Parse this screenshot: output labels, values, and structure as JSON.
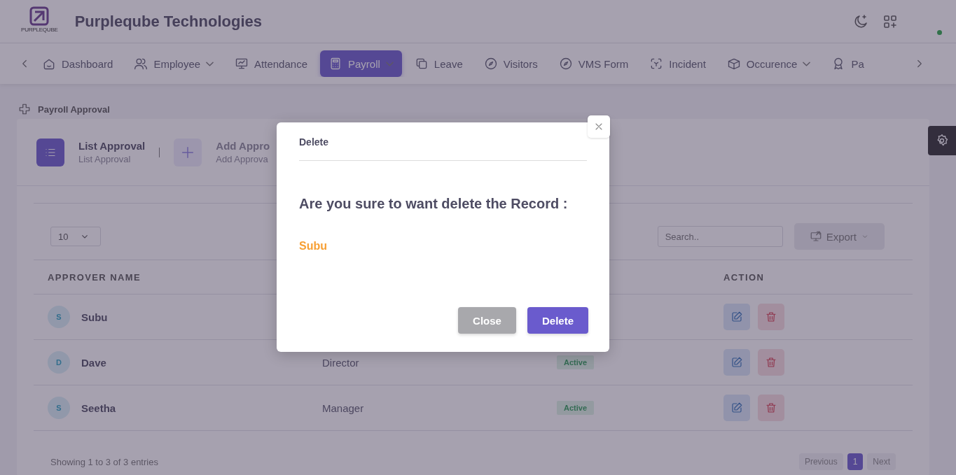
{
  "header": {
    "logo_text": "PURPLEQUBE",
    "company": "Purpleqube Technologies"
  },
  "nav": {
    "items": [
      {
        "label": "Dashboard",
        "dropdown": false,
        "selected": false
      },
      {
        "label": "Employee",
        "dropdown": true,
        "selected": false
      },
      {
        "label": "Attendance",
        "dropdown": false,
        "selected": false
      },
      {
        "label": "Payroll",
        "dropdown": true,
        "selected": true
      },
      {
        "label": "Leave",
        "dropdown": false,
        "selected": false
      },
      {
        "label": "Visitors",
        "dropdown": false,
        "selected": false
      },
      {
        "label": "VMS Form",
        "dropdown": false,
        "selected": false
      },
      {
        "label": "Incident",
        "dropdown": false,
        "selected": false
      },
      {
        "label": "Occurence",
        "dropdown": true,
        "selected": false
      },
      {
        "label": "Pa",
        "dropdown": false,
        "selected": false
      }
    ]
  },
  "breadcrumb": "Payroll Approval",
  "tabs": [
    {
      "title": "List Approval",
      "subtitle": "List Approval",
      "selected": true
    },
    {
      "title": "Add Appro",
      "subtitle": "Add Approva",
      "selected": false
    }
  ],
  "table": {
    "page_size": "10",
    "search": {
      "placeholder": "Search.."
    },
    "export": "Export",
    "columns": [
      {
        "label": "APPROVER NAME"
      },
      {
        "label": "ACTION"
      }
    ],
    "rows": [
      {
        "initial": "S",
        "name": "Subu"
      },
      {
        "initial": "D",
        "name": "Dave",
        "designation": "Director",
        "status": "Active"
      },
      {
        "initial": "S",
        "name": "Seetha",
        "designation": "Manager",
        "status": "Active"
      }
    ],
    "info": "Showing 1 to 3 of 3 entries",
    "pagination": {
      "previous": "Previous",
      "pages": [
        {
          "label": "1",
          "selected": true
        }
      ],
      "next": "Next"
    }
  },
  "modal": {
    "title": "Delete",
    "message": "Are you sure to want delete the Record :",
    "record": "Subu",
    "buttons": [
      {
        "label": "Close",
        "kind": "secondary"
      },
      {
        "label": "Delete",
        "kind": "primary"
      }
    ]
  }
}
